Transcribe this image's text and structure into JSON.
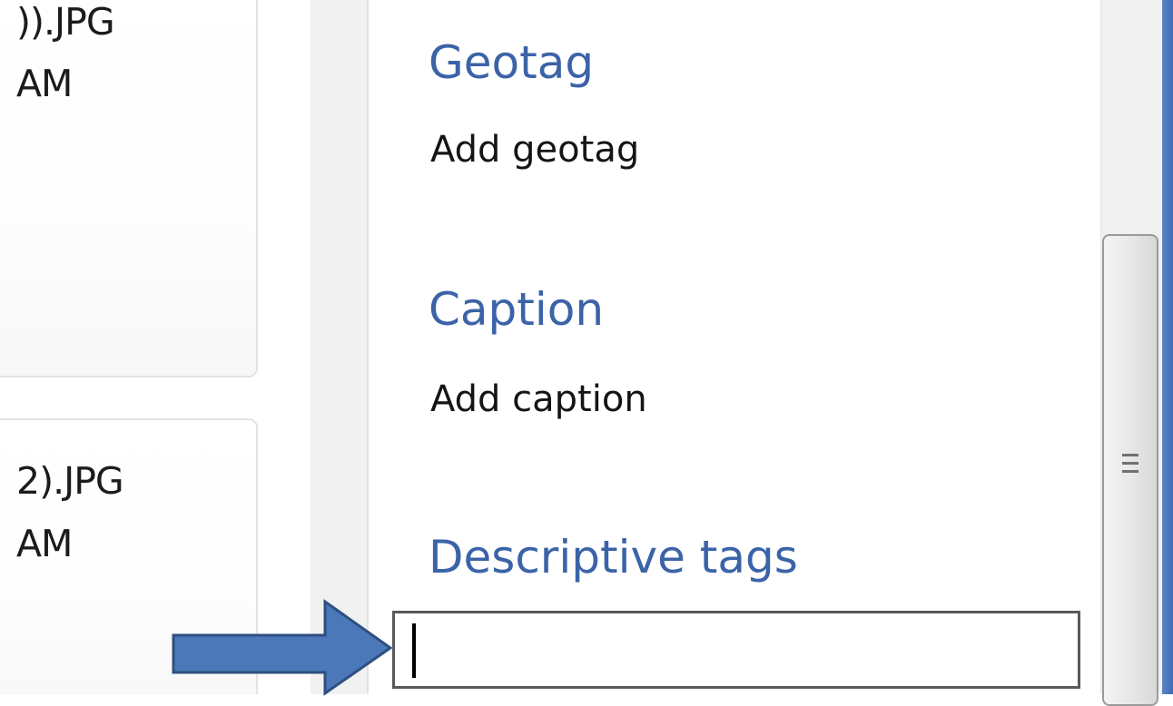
{
  "thumbnails": [
    {
      "filename": ")).JPG",
      "time": "AM"
    },
    {
      "filename": "2).JPG",
      "time": "AM"
    }
  ],
  "details": {
    "geotag": {
      "heading": "Geotag",
      "action": "Add geotag"
    },
    "caption": {
      "heading": "Caption",
      "action": "Add caption"
    },
    "tags": {
      "heading": "Descriptive tags",
      "value": ""
    }
  },
  "icons": {
    "scroll_grip": "grip-lines-icon",
    "annotation": "arrow-right-icon"
  },
  "colors": {
    "heading": "#3b63a8",
    "annotation_arrow": "#4a78b8",
    "annotation_arrow_border": "#2e4f80",
    "window_edge": "#3e6cb5"
  }
}
